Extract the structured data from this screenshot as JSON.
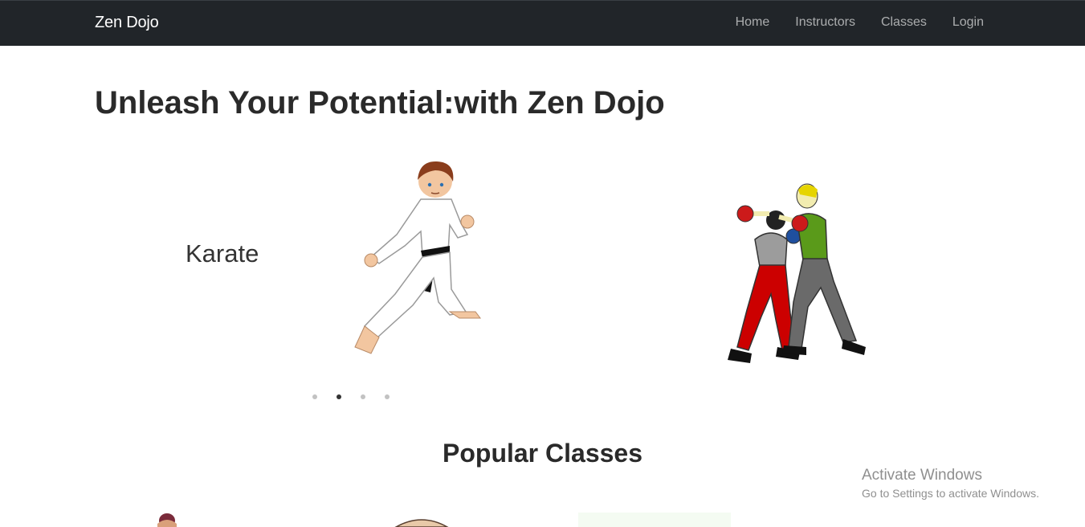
{
  "navbar": {
    "brand": "Zen Dojo",
    "links": [
      {
        "label": "Home"
      },
      {
        "label": "Instructors"
      },
      {
        "label": "Classes"
      },
      {
        "label": "Login"
      }
    ]
  },
  "hero": {
    "title": "Unleash Your Potential:with Zen Dojo"
  },
  "carousel": {
    "slide_label": "Karate",
    "active_index": 2,
    "indicator_count": 4
  },
  "popular": {
    "title": "Popular Classes"
  },
  "watermark": {
    "title": "Activate Windows",
    "subtitle": "Go to Settings to activate Windows."
  },
  "colors": {
    "navbar_bg": "#212529",
    "brand_text": "#ffffff",
    "nav_link_text": "#a6a8aa",
    "heading_text": "#2a2a2a"
  }
}
